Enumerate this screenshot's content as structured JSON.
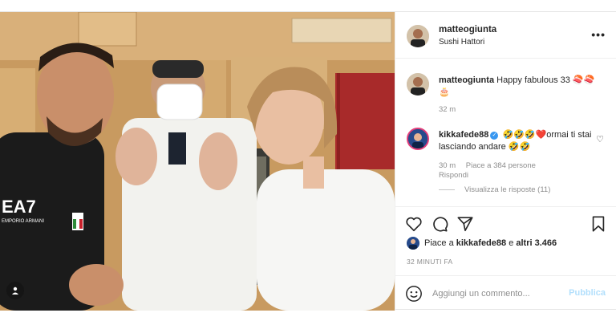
{
  "post": {
    "author": {
      "username": "matteogiunta",
      "location": "Sushi Hattori"
    },
    "caption": {
      "username": "matteogiunta",
      "text": "Happy fabulous 33 🍣🍣🎂",
      "time": "32 m"
    },
    "comments": [
      {
        "username": "kikkafede88",
        "verified": true,
        "text": "🤣🤣🤣❤️ormai ti stai lasciando andare 🤣🤣",
        "time": "30 m",
        "likes": "Piace a 384 persone",
        "reply": "Rispondi",
        "view_replies": "Visualizza le risposte (11)"
      }
    ],
    "likes_line": {
      "prefix": "Piace a ",
      "user": "kikkafede88",
      "suffix": " e ",
      "others": "altri 3.466"
    },
    "timestamp": "32 MINUTI FA",
    "comment_box": {
      "placeholder": "Aggiungi un commento...",
      "publish": "Pubblica"
    },
    "photo": {
      "shirt_text": "EA7",
      "shirt_subtext": "EMPORIO ARMANI"
    }
  },
  "icons": {
    "more": "more-icon",
    "heart": "heart-icon",
    "comment": "comment-icon",
    "share": "share-icon",
    "save": "bookmark-icon",
    "emoji": "emoji-icon"
  },
  "colors": {
    "verified": "#3897f0",
    "publish": "#b2dffc",
    "meta": "#8e8e8e"
  }
}
